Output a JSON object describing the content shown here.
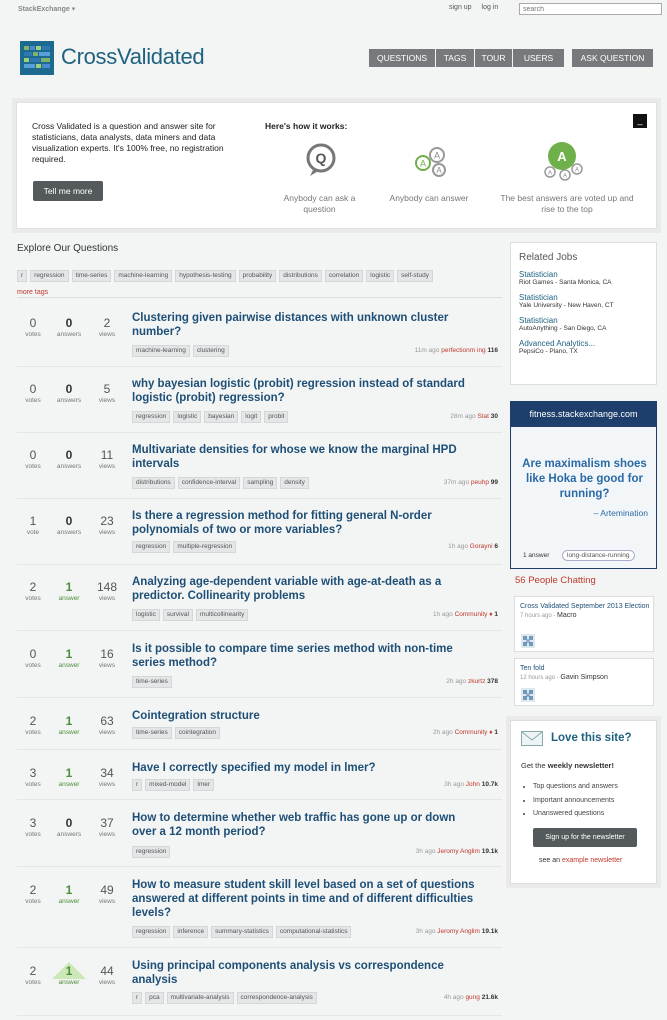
{
  "topbar": {
    "network_a": "Stack",
    "network_b": "Exchange",
    "network_caret": "▾",
    "signup": "sign up",
    "login": "log in",
    "search_placeholder": "search"
  },
  "site": {
    "name": "CrossValidated"
  },
  "nav": [
    "QUESTIONS",
    "TAGS",
    "TOUR",
    "USERS"
  ],
  "ask_button": "ASK QUESTION",
  "hero": {
    "text": "Cross Validated is a question and answer site for statisticians, data analysts, data miners and data visualization experts. It's 100% free, no registration required.",
    "button": "Tell me more",
    "how": "Here's how it works:",
    "close": "_",
    "steps": [
      {
        "text": "Anybody can ask a question"
      },
      {
        "text": "Anybody can answer"
      },
      {
        "text": "The best answers are voted up and rise to the top"
      }
    ]
  },
  "explore": "Explore Our Questions",
  "tag_strip": [
    "r",
    "regression",
    "time-series",
    "machine-learning",
    "hypothesis-testing",
    "probability",
    "distributions",
    "correlation",
    "logistic",
    "self-study"
  ],
  "more_tags": "more tags",
  "questions": [
    {
      "votes": "0",
      "votes_label": "votes",
      "answers": "0",
      "answers_label": "answers",
      "views": "2",
      "views_label": "views",
      "title": "Clustering given pairwise distances with unknown cluster number?",
      "tags": [
        "machine-learning",
        "clustering"
      ],
      "time": "11m ago",
      "user": "perfectionm ing",
      "rep": "116",
      "answered": false
    },
    {
      "votes": "0",
      "votes_label": "votes",
      "answers": "0",
      "answers_label": "answers",
      "views": "5",
      "views_label": "views",
      "title": "why bayesian logistic (probit) regression instead of standard logistic (probit) regression?",
      "tags": [
        "regression",
        "logistic",
        "bayesian",
        "logit",
        "probit"
      ],
      "time": "28m ago",
      "user": "Stat",
      "rep": "30",
      "answered": false
    },
    {
      "votes": "0",
      "votes_label": "votes",
      "answers": "0",
      "answers_label": "answers",
      "views": "11",
      "views_label": "views",
      "title": "Multivariate densities for whose we know the marginal HPD intervals",
      "tags": [
        "distributions",
        "confidence-interval",
        "sampling",
        "density"
      ],
      "time": "37m ago",
      "user": "peuhp",
      "rep": "99",
      "answered": false
    },
    {
      "votes": "1",
      "votes_label": "vote",
      "answers": "0",
      "answers_label": "answers",
      "views": "23",
      "views_label": "views",
      "title": "Is there a regression method for fitting general N-order polynomials of two or more variables?",
      "tags": [
        "regression",
        "multiple-regression"
      ],
      "time": "1h ago",
      "user": "Gorayni",
      "rep": "6",
      "answered": false
    },
    {
      "votes": "2",
      "votes_label": "votes",
      "answers": "1",
      "answers_label": "answer",
      "views": "148",
      "views_label": "views",
      "title": "Analyzing age-dependent variable with age-at-death as a predictor. Collinearity problems",
      "tags": [
        "logistic",
        "survival",
        "multicollinearity"
      ],
      "time": "1h ago",
      "user": "Community ♦",
      "rep": "1",
      "answered": true
    },
    {
      "votes": "0",
      "votes_label": "votes",
      "answers": "1",
      "answers_label": "answer",
      "views": "16",
      "views_label": "views",
      "title": "Is it possible to compare time series method with non-time series method?",
      "tags": [
        "time-series"
      ],
      "time": "2h ago",
      "user": "zkurtz",
      "rep": "378",
      "answered": true
    },
    {
      "votes": "2",
      "votes_label": "votes",
      "answers": "1",
      "answers_label": "answer",
      "views": "63",
      "views_label": "views",
      "title": "Cointegration structure",
      "tags": [
        "time-series",
        "cointegration"
      ],
      "time": "2h ago",
      "user": "Community ♦",
      "rep": "1",
      "answered": true
    },
    {
      "votes": "3",
      "votes_label": "votes",
      "answers": "1",
      "answers_label": "answer",
      "views": "34",
      "views_label": "views",
      "title": "Have I correctly specified my model in lmer?",
      "tags": [
        "r",
        "mixed-model",
        "lmer"
      ],
      "time": "3h ago",
      "user": "John",
      "rep": "10.7k",
      "answered": true
    },
    {
      "votes": "3",
      "votes_label": "votes",
      "answers": "0",
      "answers_label": "answers",
      "views": "37",
      "views_label": "views",
      "title": "How to determine whether web traffic has gone up or down over a 12 month period?",
      "tags": [
        "regression"
      ],
      "time": "3h ago",
      "user": "Jeromy Anglim",
      "rep": "19.1k",
      "answered": false
    },
    {
      "votes": "2",
      "votes_label": "votes",
      "answers": "1",
      "answers_label": "answer",
      "views": "49",
      "views_label": "views",
      "title": "How to measure student skill level based on a set of questions answered at different points in time and of different difficulties levels?",
      "tags": [
        "regression",
        "inference",
        "summary-statistics",
        "computational-statistics"
      ],
      "time": "3h ago",
      "user": "Jeromy Anglim",
      "rep": "19.1k",
      "answered": true
    },
    {
      "votes": "2",
      "votes_label": "votes",
      "answers": "1",
      "answers_label": "answer",
      "views": "44",
      "views_label": "views",
      "title": "Using principal components analysis vs correspondence analysis",
      "tags": [
        "r",
        "pca",
        "multivariate-analysis",
        "correspondence-analysis"
      ],
      "time": "4h ago",
      "user": "gung",
      "rep": "21.6k",
      "answered": true,
      "accepted": true
    }
  ],
  "jobs": {
    "heading": "Related Jobs",
    "items": [
      {
        "title": "Statistician",
        "company": "Riot Games - Santa Monica, CA"
      },
      {
        "title": "Statistician",
        "company": "Yale University - New Haven, CT"
      },
      {
        "title": "Statistician",
        "company": "AutoAnything - San Diego, CA"
      },
      {
        "title": "Advanced Analytics...",
        "company": "PepsiCo - Plano, TX"
      }
    ]
  },
  "fitness": {
    "site": "fitness.stackexchange.com",
    "question": "Are maximalism shoes like Hoka be good for running?",
    "author": "– Artemination",
    "answers": "1 answer",
    "tag": "long-distance-running"
  },
  "chat": {
    "heading": "56 People Chatting",
    "rooms": [
      {
        "name": "Cross Validated September 2013 Election",
        "time": "7 hours ago",
        "sep": " - ",
        "user": "Macro"
      },
      {
        "name": "Ten fold",
        "time": "12 hours ago",
        "sep": " - ",
        "user": "Gavin Simpson"
      }
    ]
  },
  "newsletter": {
    "heading": "Love this site?",
    "intro_a": "Get the ",
    "intro_b": "weekly newsletter!",
    "items": [
      "Top questions and answers",
      "Important announcements",
      "Unanswered questions"
    ],
    "button": "Sign up for the newsletter",
    "see_a": "see an ",
    "see_link": "example newsletter"
  },
  "colors": {
    "brand": "#1e6280",
    "nav": "#777a7c",
    "answered": "#4a8f3a",
    "accent": "#c0392b"
  }
}
